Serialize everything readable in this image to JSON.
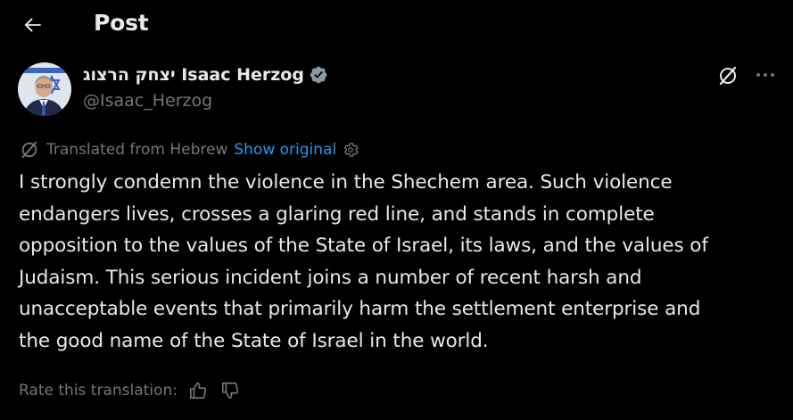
{
  "header": {
    "title": "Post",
    "back_icon": "arrow-left-icon"
  },
  "author": {
    "display_name": "יצחק הרצוג Isaac Herzog",
    "handle": "@Isaac_Herzog",
    "verified_badge": "verified-badge-icon",
    "verified_color": "#8b98a5"
  },
  "actions": {
    "grok_icon": "grok-icon",
    "more_icon": "more-icon"
  },
  "translation": {
    "label": "Translated from Hebrew",
    "show_original": "Show original",
    "settings_icon": "gear-icon"
  },
  "post": {
    "text": "I strongly condemn the violence in the Shechem area. Such violence\nendangers lives, crosses a glaring red line, and stands in complete\nopposition to the values of the State of Israel, its laws, and the values of\nJudaism. This serious incident joins a number of recent harsh and\nunacceptable events that primarily harm the settlement enterprise and\nthe good name of the State of Israel in the world."
  },
  "rating": {
    "label": "Rate this translation:",
    "thumbs_up_icon": "thumbs-up-icon",
    "thumbs_down_icon": "thumbs-down-icon"
  },
  "colors": {
    "background": "#000000",
    "text_primary": "#e7e9ea",
    "text_secondary": "#71767b",
    "link": "#1d9bf0"
  }
}
